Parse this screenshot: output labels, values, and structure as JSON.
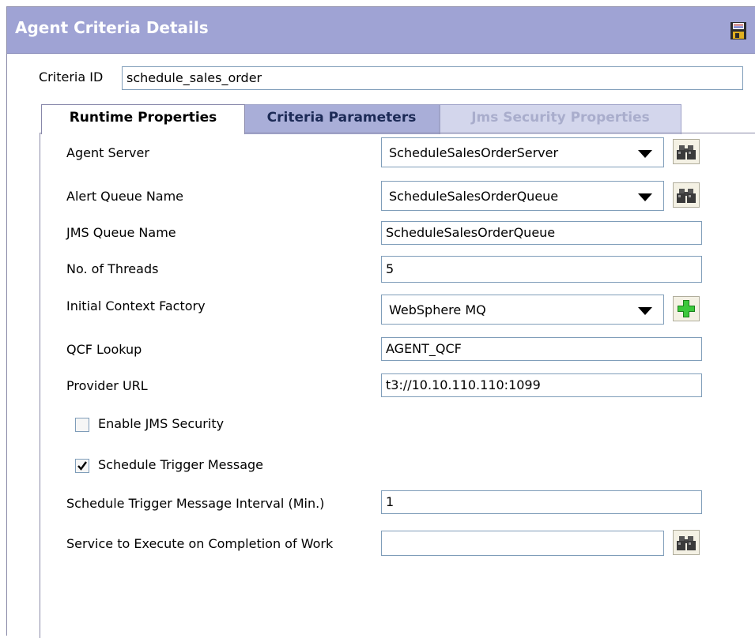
{
  "panel": {
    "title": "Agent Criteria Details",
    "save_icon": "save-icon"
  },
  "criteria": {
    "label": "Criteria ID",
    "value": "schedule_sales_order"
  },
  "tabs": [
    {
      "label": "Runtime Properties",
      "state": "active"
    },
    {
      "label": "Criteria Parameters",
      "state": "inactive"
    },
    {
      "label": "Jms Security Properties",
      "state": "disabled"
    }
  ],
  "form": {
    "agent_server": {
      "label": "Agent Server",
      "value": "ScheduleSalesOrderServer",
      "icon": "binoculars-icon"
    },
    "alert_queue": {
      "label": "Alert Queue Name",
      "value": "ScheduleSalesOrderQueue",
      "icon": "binoculars-icon"
    },
    "jms_queue": {
      "label": "JMS Queue Name",
      "value": "ScheduleSalesOrderQueue"
    },
    "threads": {
      "label": "No. of Threads",
      "value": "5"
    },
    "context_factory": {
      "label": "Initial Context Factory",
      "value": "WebSphere MQ",
      "icon": "add-plus-icon"
    },
    "qcf_lookup": {
      "label": "QCF Lookup",
      "value": "AGENT_QCF"
    },
    "provider_url": {
      "label": "Provider URL",
      "value": "t3://10.10.110.110:1099"
    },
    "enable_jms_security": {
      "label": "Enable JMS Security",
      "checked": false
    },
    "schedule_trigger": {
      "label": "Schedule Trigger Message",
      "checked": true
    },
    "trigger_interval": {
      "label": "Schedule Trigger Message Interval (Min.)",
      "value": "1"
    },
    "service_on_completion": {
      "label": "Service to Execute on Completion of Work",
      "value": "",
      "icon": "binoculars-icon"
    }
  },
  "colors": {
    "title_bar": "#9fa3d4",
    "active_tab": "#ffffff",
    "inactive_tab": "#a9aed8",
    "disabled_tab": "#d3d6ec",
    "add_icon": "#22a822"
  }
}
